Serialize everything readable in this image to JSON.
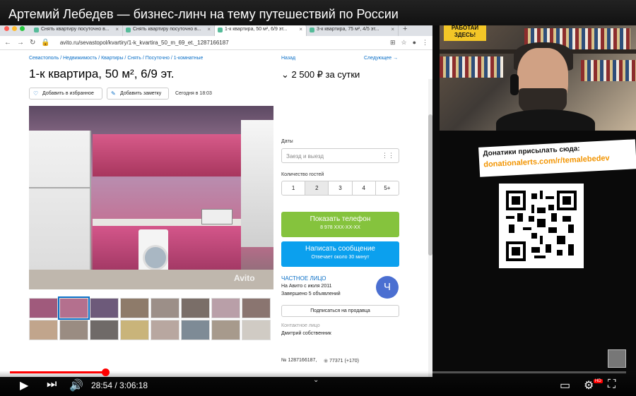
{
  "video": {
    "title": "Артемий Лебедев — бизнес-линч на тему путешествий по России",
    "time_current": "28:54",
    "time_total": "3:06:18",
    "time_display": "28:54 / 3:06:18",
    "progress": 0.155,
    "hd_badge": "HD"
  },
  "browser": {
    "tabs": [
      {
        "label": "Снять квартиру посуточно в..."
      },
      {
        "label": "Снять квартиру посуточно в..."
      },
      {
        "label": "1-к квартира, 50 м², 6/9 эт..."
      },
      {
        "label": "3-к квартира, 75 м², 4/5 эт..."
      }
    ],
    "active_tab": 2,
    "new_tab": "+",
    "url": "avito.ru/sevastopol/kvartiry/1-k_kvartira_50_m_69_et._1287166187"
  },
  "listing": {
    "breadcrumb": "Севастополь / Недвижимость / Квартиры / Снять / Посуточно / 1-комнатные",
    "nav_back": "Назад",
    "nav_next": "Следующее →",
    "title": "1-к квартира, 50 м², 6/9 эт.",
    "price": "2 500 ₽ за сутки",
    "price_caret": "⌄",
    "fav_label": "Добавить в избранное",
    "note_label": "Добавить заметку",
    "posted": "Сегодня в 18:03",
    "photo_brand": "Avito",
    "dates_label": "Даты",
    "dates_placeholder": "Заезд и выезд",
    "guests_label": "Количество гостей",
    "guests": [
      "1",
      "2",
      "3",
      "4",
      "5+"
    ],
    "guests_selected": 1,
    "phone_button": "Показать телефон",
    "phone_number": "8 978 XXX-XX-XX",
    "message_button": "Написать сообщение",
    "message_sub": "Отвечает около 30 минут",
    "seller_type": "ЧАСТНОЕ ЛИЦО",
    "seller_since": "На Авито с июля 2011",
    "seller_done": "Завершено 5 объявлений",
    "seller_initial": "Ч",
    "subscribe_button": "Подписаться на продавца",
    "contact_label": "Контактное лицо",
    "contact_name": "Дмитрий собственник",
    "ad_id": "№ 1287166187,",
    "ad_views": "77371 (+170)"
  },
  "stream": {
    "sign_text": "РАБОТАЙ ЗДЕСЬ!",
    "donate_line1": "Донатики присылать сюда:",
    "donate_line2": "donationalerts.com/r/temalebedev"
  },
  "colors": {
    "avito_blue": "#0a6fc7",
    "phone_green": "#85c33d",
    "message_blue": "#0ba0ee",
    "yt_red": "#ff0000",
    "donate_orange": "#f29400"
  }
}
